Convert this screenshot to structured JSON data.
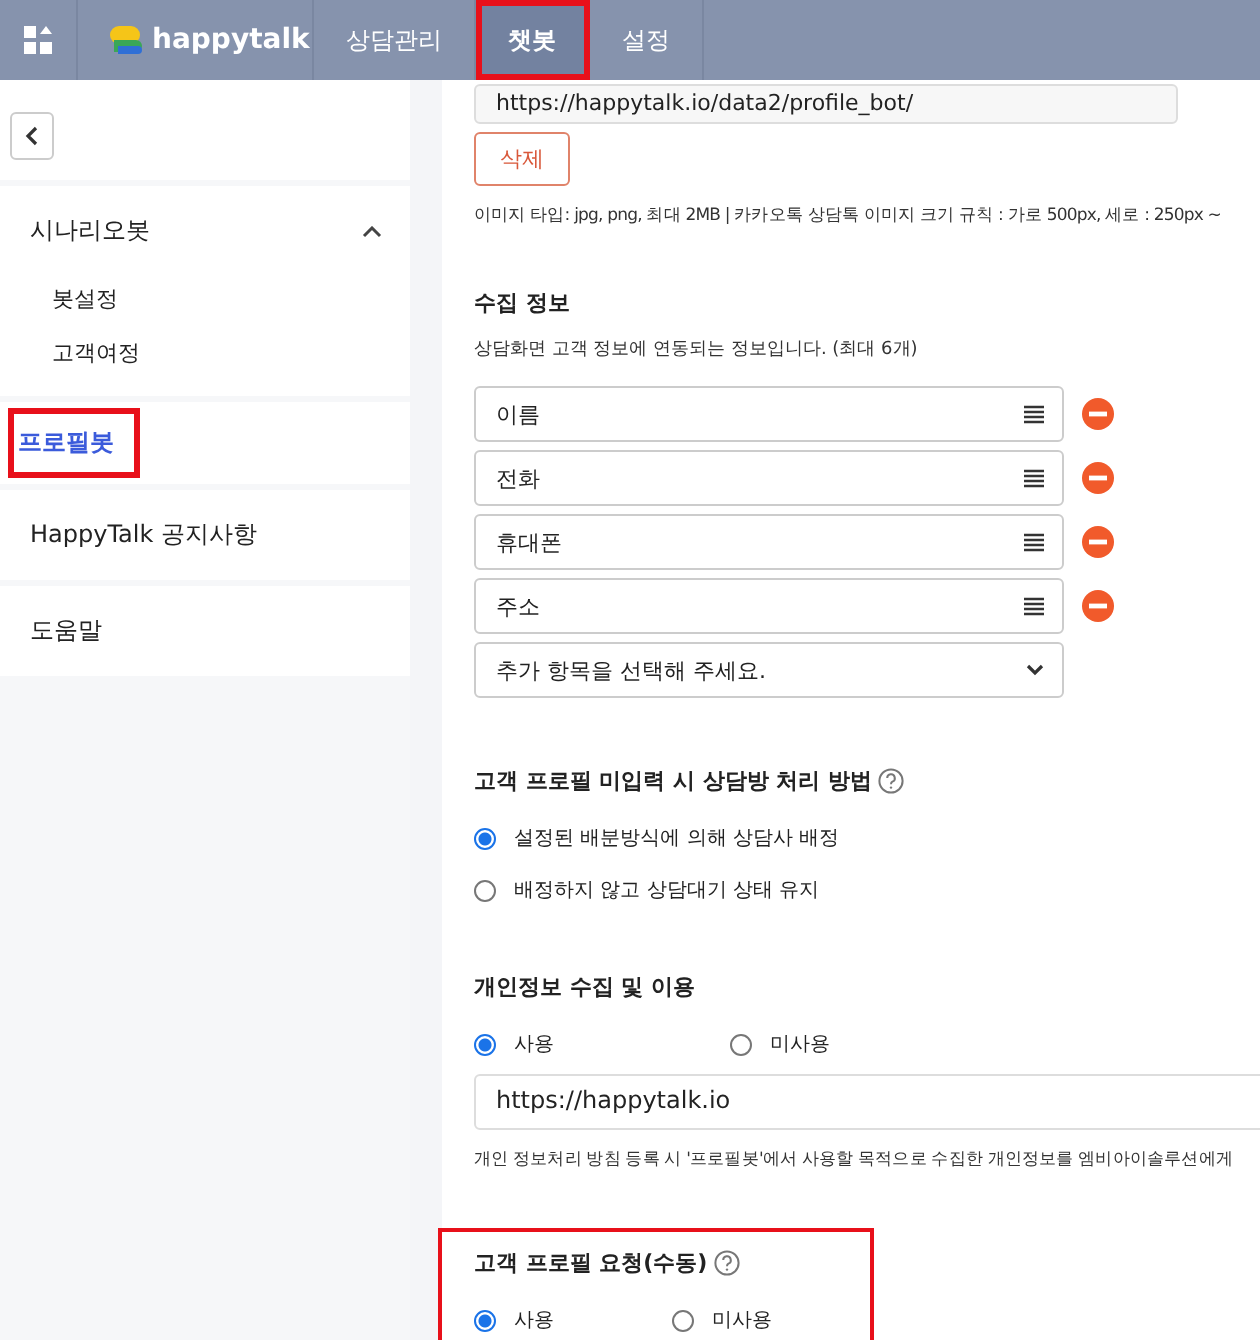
{
  "top_nav": {
    "brand": "happytalk",
    "tabs": [
      {
        "label": "상담관리",
        "selected": false,
        "highlighted": false
      },
      {
        "label": "챗봇",
        "selected": true,
        "highlighted": true
      },
      {
        "label": "설정",
        "selected": false,
        "highlighted": false
      }
    ]
  },
  "sidebar": {
    "items": [
      {
        "label": "시나리오봇",
        "expanded": true,
        "selected": false,
        "highlighted": false,
        "children": [
          {
            "label": "봇설정"
          },
          {
            "label": "고객여정"
          }
        ]
      },
      {
        "label": "프로필봇",
        "selected": true,
        "highlighted": true
      },
      {
        "label": "HappyTalk 공지사항",
        "selected": false,
        "highlighted": false
      },
      {
        "label": "도움말",
        "selected": false,
        "highlighted": false
      }
    ]
  },
  "image": {
    "url_value": "https://happytalk.io/data2/profile_bot/",
    "delete_button": "삭제",
    "hint": "이미지 타입: jpg, png, 최대 2MB | 카카오톡 상담톡 이미지 크기 규칙 : 가로 500px, 세로 : 250px ~"
  },
  "collect": {
    "title": "수집 정보",
    "description": "상담화면 고객 정보에 연동되는 정보입니다. (최대 6개)",
    "fields": [
      {
        "label": "이름"
      },
      {
        "label": "전화"
      },
      {
        "label": "휴대폰"
      },
      {
        "label": "주소"
      }
    ],
    "add_placeholder": "추가 항목을 선택해 주세요."
  },
  "sections": [
    {
      "title": "고객 프로필 미입력 시 상담방 처리 방법",
      "help": true,
      "highlighted": false,
      "kind": "stacked",
      "options": [
        {
          "label": "설정된 배분방식에 의해 상담사 배정",
          "selected": true
        },
        {
          "label": "배정하지 않고 상담대기 상태 유지",
          "selected": false
        }
      ]
    },
    {
      "title": "개인정보 수집 및 이용",
      "help": false,
      "highlighted": false,
      "kind": "inline",
      "options": [
        {
          "label": "사용",
          "selected": true
        },
        {
          "label": "미사용",
          "selected": false
        }
      ],
      "url_value": "https://happytalk.io",
      "note": "개인 정보처리 방침 등록 시 '프로필봇'에서 사용할 목적으로 수집한 개인정보를 엠비아이솔루션에게"
    },
    {
      "title": "고객 프로필 요청(수동)",
      "help": true,
      "highlighted": true,
      "kind": "inline",
      "options": [
        {
          "label": "사용",
          "selected": true
        },
        {
          "label": "미사용",
          "selected": false
        }
      ]
    }
  ]
}
